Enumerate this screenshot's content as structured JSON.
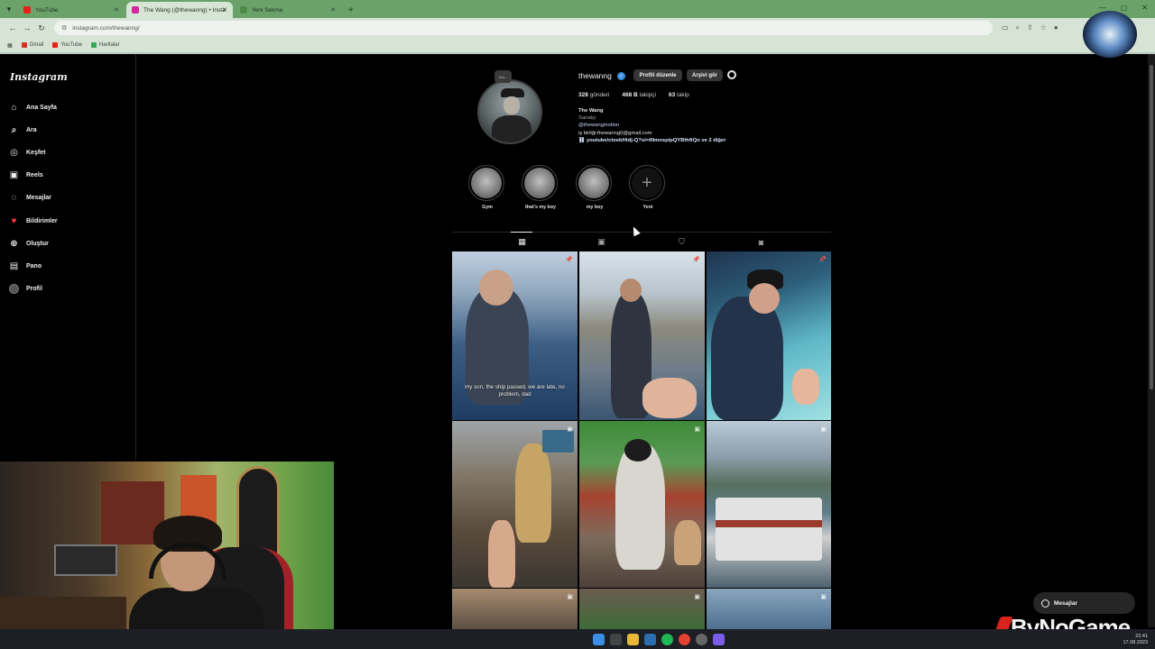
{
  "browser": {
    "tabs": [
      {
        "title": "YouTube",
        "fav_color": "#e62117"
      },
      {
        "title": "The Wang (@thewanng) • Insta",
        "fav_color": "#d6249f"
      },
      {
        "title": "Yeni Sekme",
        "fav_color": "#4d8a4a"
      }
    ],
    "url": "instagram.com/thewanng/",
    "bookmarks": [
      {
        "label": "Gmail",
        "color": "#d93025"
      },
      {
        "label": "YouTube",
        "color": "#e62117"
      },
      {
        "label": "Haritalar",
        "color": "#34a853"
      }
    ]
  },
  "sidebar": {
    "logo": "Instagram",
    "items": [
      {
        "label": "Ana Sayfa",
        "icon": "home-icon",
        "glyph": "⌂"
      },
      {
        "label": "Ara",
        "icon": "search-icon",
        "glyph": "○"
      },
      {
        "label": "Keşfet",
        "icon": "compass-icon",
        "glyph": "◎"
      },
      {
        "label": "Reels",
        "icon": "reels-icon",
        "glyph": "▣"
      },
      {
        "label": "Mesajlar",
        "icon": "messenger-icon",
        "glyph": "◌"
      },
      {
        "label": "Bildirimler",
        "icon": "heart-icon",
        "glyph": "♥"
      },
      {
        "label": "Oluştur",
        "icon": "plus-square-icon",
        "glyph": "⊕"
      },
      {
        "label": "Pano",
        "icon": "dashboard-icon",
        "glyph": "▤"
      },
      {
        "label": "Profil",
        "icon": "profile-avatar",
        "glyph": ""
      }
    ]
  },
  "profile": {
    "username": "thewanng",
    "note": "Not...",
    "edit_button": "Profili düzenle",
    "archive_button": "Arşivi gör",
    "stats": {
      "posts_count": "328",
      "posts_label": "gönderi",
      "followers_count": "468 B",
      "followers_label": "takipçi",
      "following_count": "63",
      "following_label": "takip"
    },
    "bio": {
      "name": "The Wang",
      "category": "Sanatçı",
      "tag": "@thewangmotion",
      "email": "iş birliği:thewanng0@gmail.com",
      "link": "youtube/ctoebHtdj-Q?si=tNmnspipQYBthftQo ve 2 diğer"
    }
  },
  "highlights": [
    {
      "label": "Gym"
    },
    {
      "label": "that's my boy"
    },
    {
      "label": "my boy"
    },
    {
      "label": "Yeni"
    }
  ],
  "posts": [
    {
      "caption": "my son, the ship passed, we are late, no problem, dad"
    }
  ],
  "messages_button": "Mesajlar",
  "watermark": "ByNoGame",
  "clock": {
    "time": "22:41",
    "date": "17.08.2023"
  }
}
